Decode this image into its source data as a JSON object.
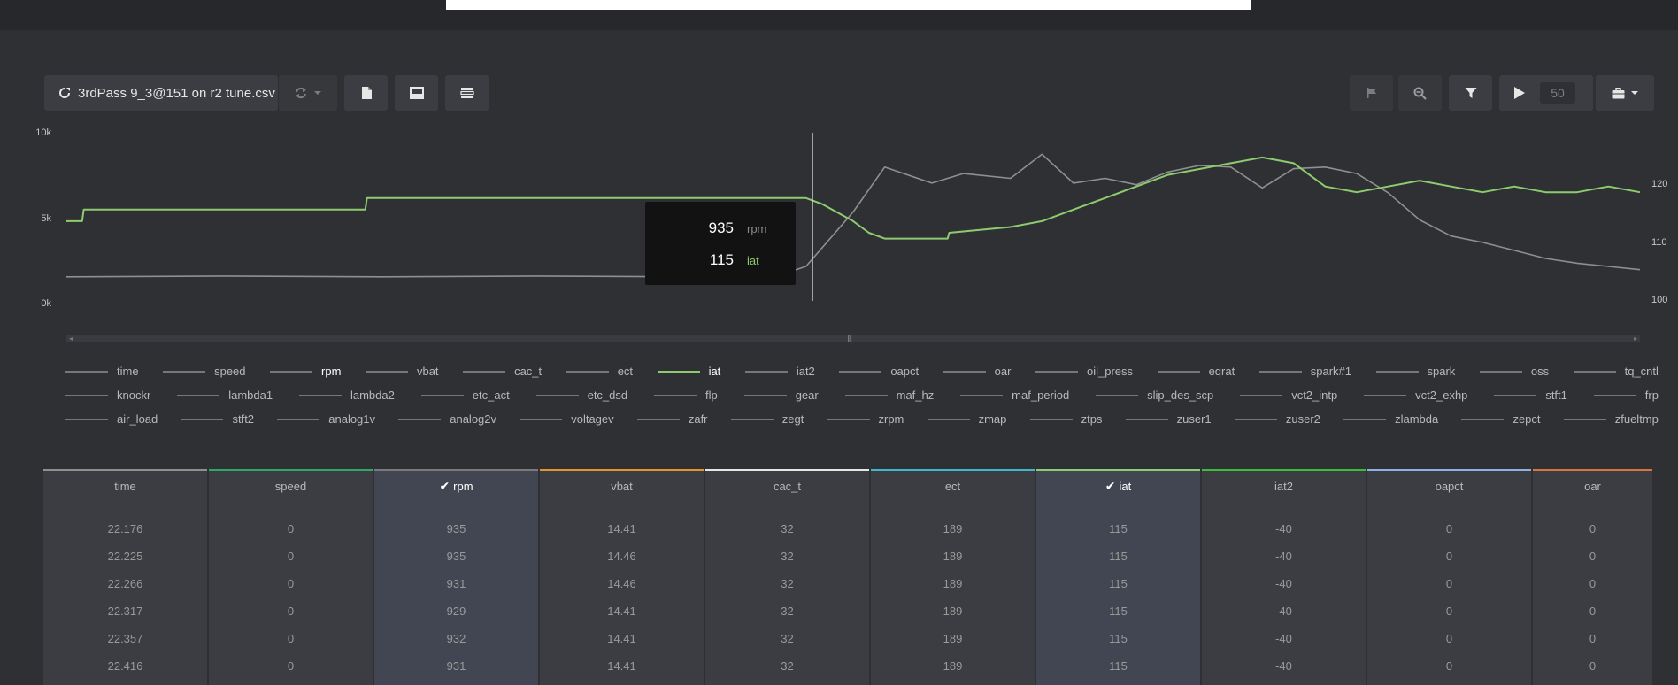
{
  "toolbar": {
    "file_name": "3rdPass 9_3@151 on r2 tune.csv",
    "speed_value": "50"
  },
  "chart": {
    "left_axis_ticks": [
      "10k",
      "5k",
      "0k"
    ],
    "right_axis_ticks": [
      "120",
      "110",
      "100"
    ],
    "tooltip": [
      {
        "value": "935",
        "name": "rpm",
        "color": "#8a8a8a"
      },
      {
        "value": "115",
        "name": "iat",
        "color": "#8dcc6e"
      }
    ]
  },
  "colors": {
    "background": "#2f3034",
    "panel": "#3b3d42",
    "iat_series": "#8dcc6e",
    "rpm_series": "#8f8f8f",
    "cursor": "#e0e0e0"
  },
  "chart_data": {
    "type": "line",
    "series": [
      {
        "name": "rpm",
        "axis": "left",
        "x": [
          0,
          10,
          20,
          30,
          40,
          45,
          47,
          50,
          52,
          55,
          57,
          60,
          62,
          64,
          66,
          68,
          70,
          72,
          74,
          76,
          78,
          80,
          82,
          84,
          86,
          88,
          90,
          92,
          94,
          96,
          98,
          100
        ],
        "y": [
          950,
          1000,
          950,
          1000,
          950,
          950,
          1600,
          5000,
          7800,
          6800,
          7400,
          7100,
          8600,
          6800,
          7100,
          6700,
          7500,
          7900,
          7800,
          6500,
          7700,
          7800,
          7400,
          6200,
          4500,
          3500,
          3100,
          2600,
          2100,
          1800,
          1600,
          1400
        ]
      },
      {
        "name": "iat",
        "axis": "right",
        "x": [
          0,
          1,
          1.1,
          19,
          19.1,
          47,
          48,
          50,
          51,
          52,
          56,
          56.1,
          60,
          62,
          64,
          66,
          68,
          70,
          72,
          74,
          76,
          78,
          80,
          82,
          84,
          86,
          88,
          90,
          92,
          94,
          96,
          98,
          100
        ],
        "y": [
          111,
          111,
          113,
          113,
          115,
          115,
          114,
          111,
          109,
          108,
          108,
          109,
          110,
          111,
          113,
          115,
          117,
          119,
          120,
          121,
          122,
          121,
          117,
          116,
          117,
          118,
          117,
          116,
          117,
          116,
          116,
          117,
          116
        ]
      }
    ],
    "xlabel": "",
    "ylabel": "",
    "ylim_left": [
      0,
      10000
    ],
    "ylim_right": [
      100,
      125
    ],
    "grid": false,
    "cursor": {
      "rpm": 935,
      "iat": 115
    }
  },
  "legend": [
    [
      "time",
      "speed",
      "rpm",
      "vbat",
      "cac_t",
      "ect",
      "iat",
      "iat2",
      "oapct",
      "oar",
      "oil_press",
      "eqrat",
      "spark#1",
      "spark",
      "oss",
      "tq_cntl"
    ],
    [
      "knockr",
      "lambda1",
      "lambda2",
      "etc_act",
      "etc_dsd",
      "flp",
      "gear",
      "maf_hz",
      "maf_period",
      "slip_des_scp",
      "vct2_intp",
      "vct2_exhp",
      "stft1",
      "frp"
    ],
    [
      "air_load",
      "stft2",
      "analog1v",
      "analog2v",
      "voltagev",
      "zafr",
      "zegt",
      "zrpm",
      "zmap",
      "ztps",
      "zuser1",
      "zuser2",
      "zlambda",
      "zepct",
      "zfueltmp"
    ]
  ],
  "table": {
    "columns": [
      {
        "name": "time",
        "color": "#8f8f8f",
        "selected": false
      },
      {
        "name": "speed",
        "color": "#2ea866",
        "selected": false
      },
      {
        "name": "rpm",
        "color": "#7a7a7a",
        "selected": true
      },
      {
        "name": "vbat",
        "color": "#e0962b",
        "selected": false
      },
      {
        "name": "cac_t",
        "color": "#e6e6e6",
        "selected": false
      },
      {
        "name": "ect",
        "color": "#3fb8c9",
        "selected": false
      },
      {
        "name": "iat",
        "color": "#8dcc6e",
        "selected": true
      },
      {
        "name": "iat2",
        "color": "#3bbf3b",
        "selected": false
      },
      {
        "name": "oapct",
        "color": "#8fb0e0",
        "selected": false
      },
      {
        "name": "oar",
        "color": "#d9743e",
        "selected": false
      }
    ],
    "rows": [
      [
        "22.176",
        "0",
        "935",
        "14.41",
        "32",
        "189",
        "115",
        "-40",
        "0",
        "0"
      ],
      [
        "22.225",
        "0",
        "935",
        "14.46",
        "32",
        "189",
        "115",
        "-40",
        "0",
        "0"
      ],
      [
        "22.266",
        "0",
        "931",
        "14.46",
        "32",
        "189",
        "115",
        "-40",
        "0",
        "0"
      ],
      [
        "22.317",
        "0",
        "929",
        "14.41",
        "32",
        "189",
        "115",
        "-40",
        "0",
        "0"
      ],
      [
        "22.357",
        "0",
        "932",
        "14.41",
        "32",
        "189",
        "115",
        "-40",
        "0",
        "0"
      ],
      [
        "22.416",
        "0",
        "931",
        "14.41",
        "32",
        "189",
        "115",
        "-40",
        "0",
        "0"
      ]
    ]
  }
}
